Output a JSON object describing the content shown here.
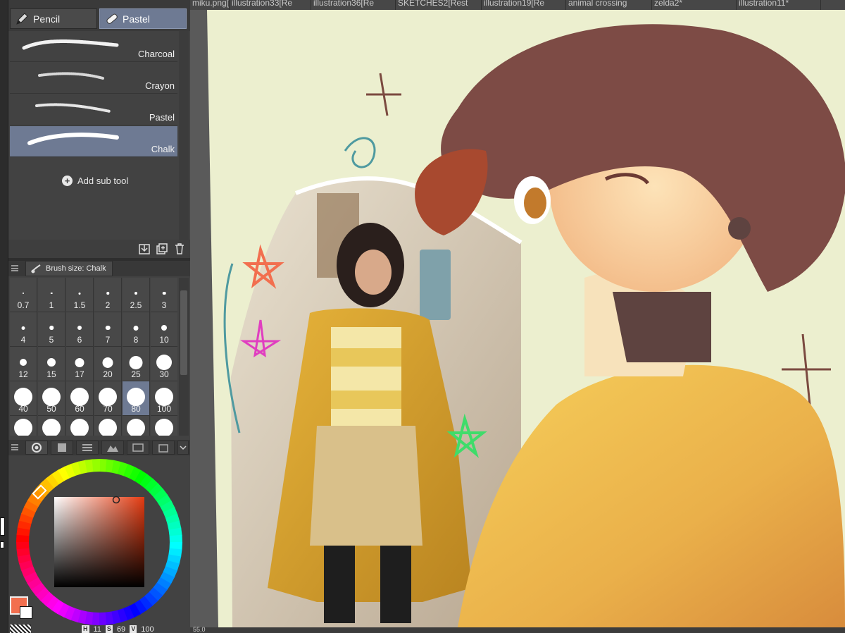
{
  "subtool": {
    "tabs": [
      {
        "label": "Pencil"
      },
      {
        "label": "Pastel"
      }
    ],
    "brushes": [
      {
        "label": "Charcoal"
      },
      {
        "label": "Crayon"
      },
      {
        "label": "Pastel"
      },
      {
        "label": "Chalk"
      }
    ],
    "selected_brush": "Chalk",
    "add_label": "Add sub tool"
  },
  "brush_size": {
    "tab_label": "Brush size: Chalk",
    "sizes": [
      "0.7",
      "1",
      "1.5",
      "2",
      "2.5",
      "3",
      "4",
      "5",
      "6",
      "7",
      "8",
      "10",
      "12",
      "15",
      "17",
      "20",
      "25",
      "30",
      "40",
      "50",
      "60",
      "70",
      "80",
      "100",
      "",
      "",
      "",
      "",
      "",
      ""
    ],
    "selected": "80"
  },
  "color": {
    "foreground": "#f26f4f",
    "background": "#ffffff",
    "hsv": {
      "h_label": "H",
      "h": "11",
      "s_label": "S",
      "s": "69",
      "v_label": "V",
      "v": "100"
    }
  },
  "document_tabs": [
    "miku.png[",
    "illustration33[Re",
    "illustration36[Re",
    "SKETCHES2[Rest",
    "illustration19[Re",
    "animal crossing",
    "zelda2*",
    "illustration11*"
  ],
  "status": {
    "zoom": "55.0"
  }
}
